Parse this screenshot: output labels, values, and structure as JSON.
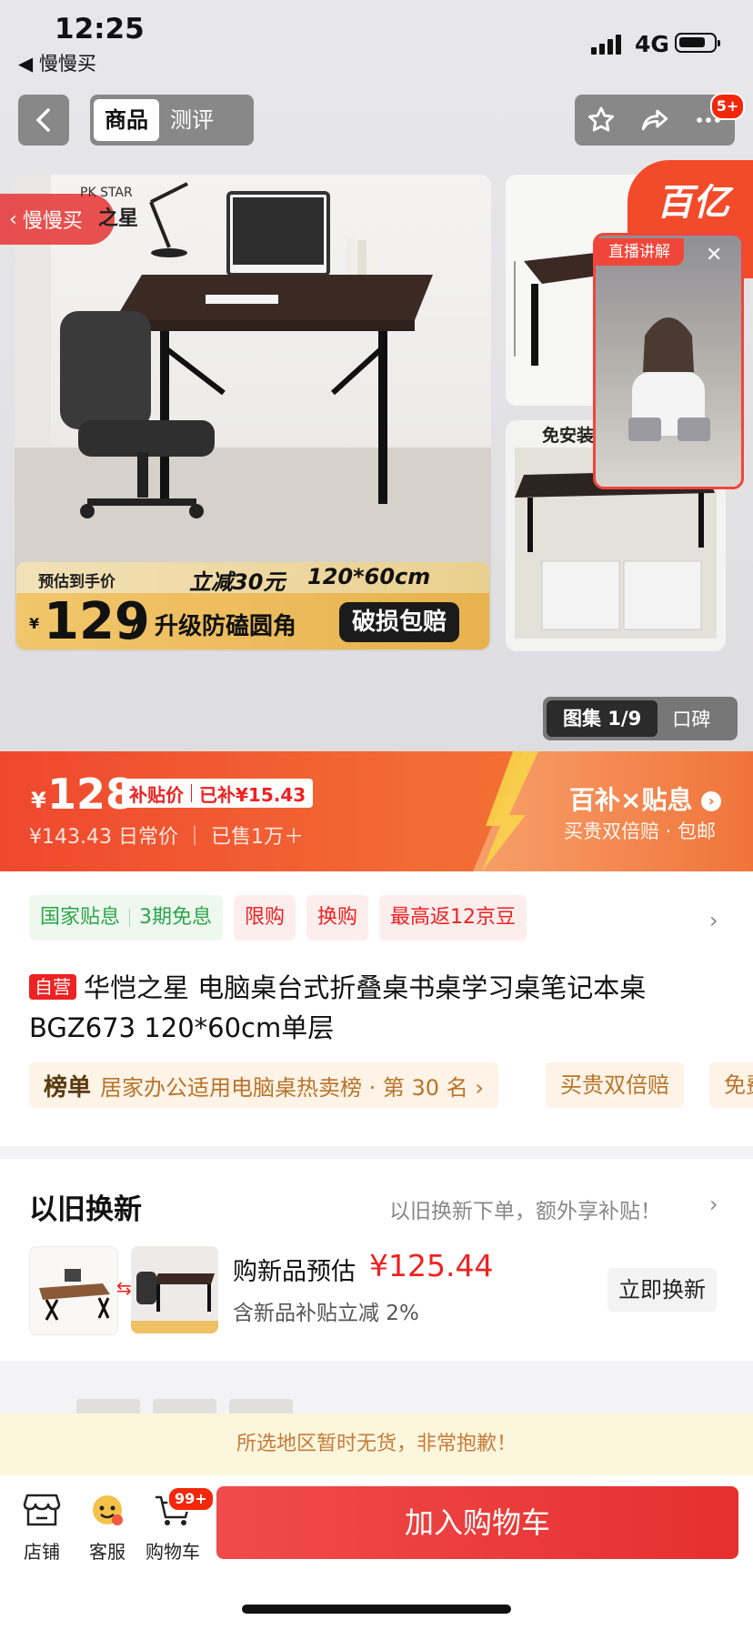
{
  "status": {
    "time": "12:25",
    "back_app": "◀ 慢慢买",
    "network": "4G"
  },
  "nav": {
    "tabs": [
      {
        "label": "商品"
      },
      {
        "label": "测评"
      }
    ],
    "badge": "5+"
  },
  "gallery": {
    "slow_buy": "慢慢买",
    "brand_en": "PK STAR",
    "brand_cn": "之星",
    "price_bar": {
      "estimate_label": "预估到手价",
      "reduce": "立减30元",
      "size": "120*60cm",
      "currency": "¥",
      "price": "129",
      "upgrade": "升级防磕圆角",
      "damage": "破损包赔"
    },
    "free_install": "免安装",
    "yi_badge": "百亿",
    "live_tag": "直播讲解",
    "album": {
      "active": "图集 1/9",
      "review": "口碑"
    }
  },
  "price": {
    "currency": "¥",
    "value": "128",
    "subsidy_label": "补贴价",
    "subsidy_amount": "已补¥15.43",
    "daily": "¥143.43  日常价  ｜ 已售1万＋",
    "promo_title": "百补×贴息",
    "promo_sub": "买贵双倍赔 · 包邮"
  },
  "tags": {
    "gov": "国家贴息",
    "installment": "3期免息",
    "limit": "限购",
    "exchange": "换购",
    "beans": "最高返12京豆"
  },
  "product": {
    "self_label": "自营",
    "title": "华恺之星 电脑桌台式折叠桌书桌学习桌笔记本桌BGZ673 120*60cm单层",
    "rank_label": "榜单",
    "rank_text": "居家办公适用电脑桌热卖榜 · 第 30 名 ›",
    "chip1": "买贵双倍赔",
    "chip2": "免费"
  },
  "tradein": {
    "title": "以旧换新",
    "hint": "以旧换新下单，额外享补贴！",
    "new_label": "购新品预估",
    "new_price": "¥125.44",
    "new_sub": "含新品补贴立减 2%",
    "button": "立即换新"
  },
  "notice": "所选地区暂时无货，非常抱歉！",
  "bottom": {
    "store": "店铺",
    "service": "客服",
    "cart": "购物车",
    "cart_badge": "99+",
    "add_cart": "加入购物车"
  },
  "colors": {
    "accent": "#F2270C",
    "primary_btn": "#E62F2F",
    "band": "#F0482E"
  }
}
